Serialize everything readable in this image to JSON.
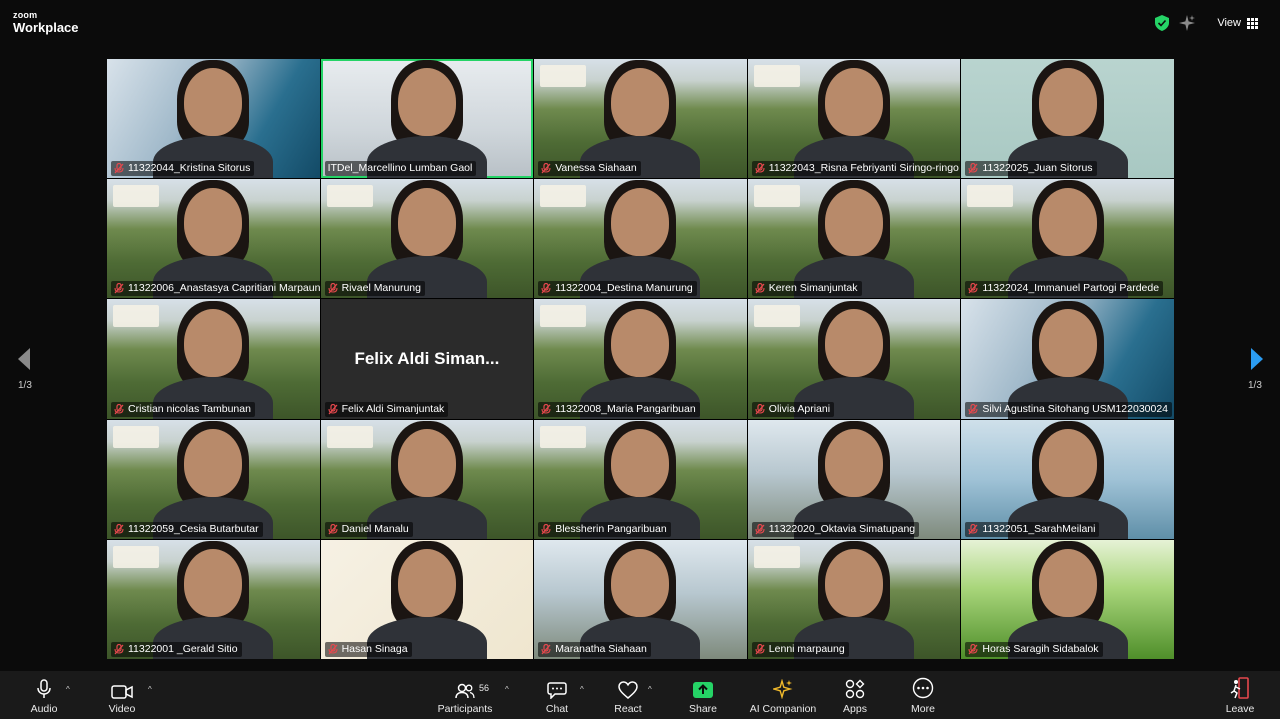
{
  "app": {
    "brand_small": "zoom",
    "brand_large": "Workplace"
  },
  "header": {
    "view_label": "View"
  },
  "pagination": {
    "left": "1/3",
    "right": "1/3"
  },
  "participants": [
    {
      "name": "11322044_Kristina Sitorus",
      "bg": "tech",
      "muted": true
    },
    {
      "name": "ITDel_Marcellino Lumban Gaol",
      "bg": "room",
      "muted": false,
      "active": true
    },
    {
      "name": "Vanessa Siahaan",
      "bg": "campus",
      "muted": true
    },
    {
      "name": "11322043_Risna Febriyanti Siringo-ringo",
      "bg": "campus",
      "muted": true
    },
    {
      "name": "11322025_Juan Sitorus",
      "bg": "wall",
      "muted": true
    },
    {
      "name": "11322006_Anastasya Capritiani Marpaung",
      "bg": "campus",
      "muted": true
    },
    {
      "name": "Rivael Manurung",
      "bg": "campus",
      "muted": true
    },
    {
      "name": "11322004_Destina Manurung",
      "bg": "campus",
      "muted": true
    },
    {
      "name": "Keren Simanjuntak",
      "bg": "campus",
      "muted": true
    },
    {
      "name": "11322024_Immanuel Partogi Pardede",
      "bg": "campus",
      "muted": true
    },
    {
      "name": "Cristian nicolas Tambunan",
      "bg": "campus",
      "muted": true
    },
    {
      "name": "Felix Aldi Simanjuntak",
      "bg": "dark",
      "muted": true,
      "video_off": true,
      "display_name": "Felix Aldi Siman..."
    },
    {
      "name": "11322008_Maria Pangaribuan",
      "bg": "campus",
      "muted": true
    },
    {
      "name": "Olivia Apriani",
      "bg": "campus",
      "muted": true
    },
    {
      "name": "Silvi Agustina Sitohang USM122030024",
      "bg": "tech",
      "muted": true
    },
    {
      "name": "11322059_Cesia Butarbutar",
      "bg": "campus",
      "muted": true
    },
    {
      "name": "Daniel Manalu",
      "bg": "campus",
      "muted": true
    },
    {
      "name": "Blessherin Pangaribuan",
      "bg": "campus",
      "muted": true
    },
    {
      "name": "11322020_Oktavia Simatupang",
      "bg": "monument",
      "muted": true
    },
    {
      "name": "11322051_SarahMeilani",
      "bg": "pool",
      "muted": true
    },
    {
      "name": "11322001 _Gerald Sitio",
      "bg": "campus",
      "muted": true
    },
    {
      "name": "Hasan Sinaga",
      "bg": "cartoon",
      "muted": true
    },
    {
      "name": "Maranatha Siahaan",
      "bg": "monument",
      "muted": true
    },
    {
      "name": "Lenni marpaung",
      "bg": "campus",
      "muted": true
    },
    {
      "name": "Horas Saragih Sidabalok",
      "bg": "grass",
      "muted": true
    }
  ],
  "toolbar": {
    "audio": "Audio",
    "video": "Video",
    "participants": "Participants",
    "participants_count": "56",
    "chat": "Chat",
    "react": "React",
    "share": "Share",
    "ai_companion": "AI Companion",
    "apps": "Apps",
    "more": "More",
    "leave": "Leave"
  },
  "colors": {
    "share_green": "#25d366",
    "ai_gold": "#f0b92b",
    "leave_red": "#e5484d",
    "arrow_blue": "#2b9cf2"
  }
}
